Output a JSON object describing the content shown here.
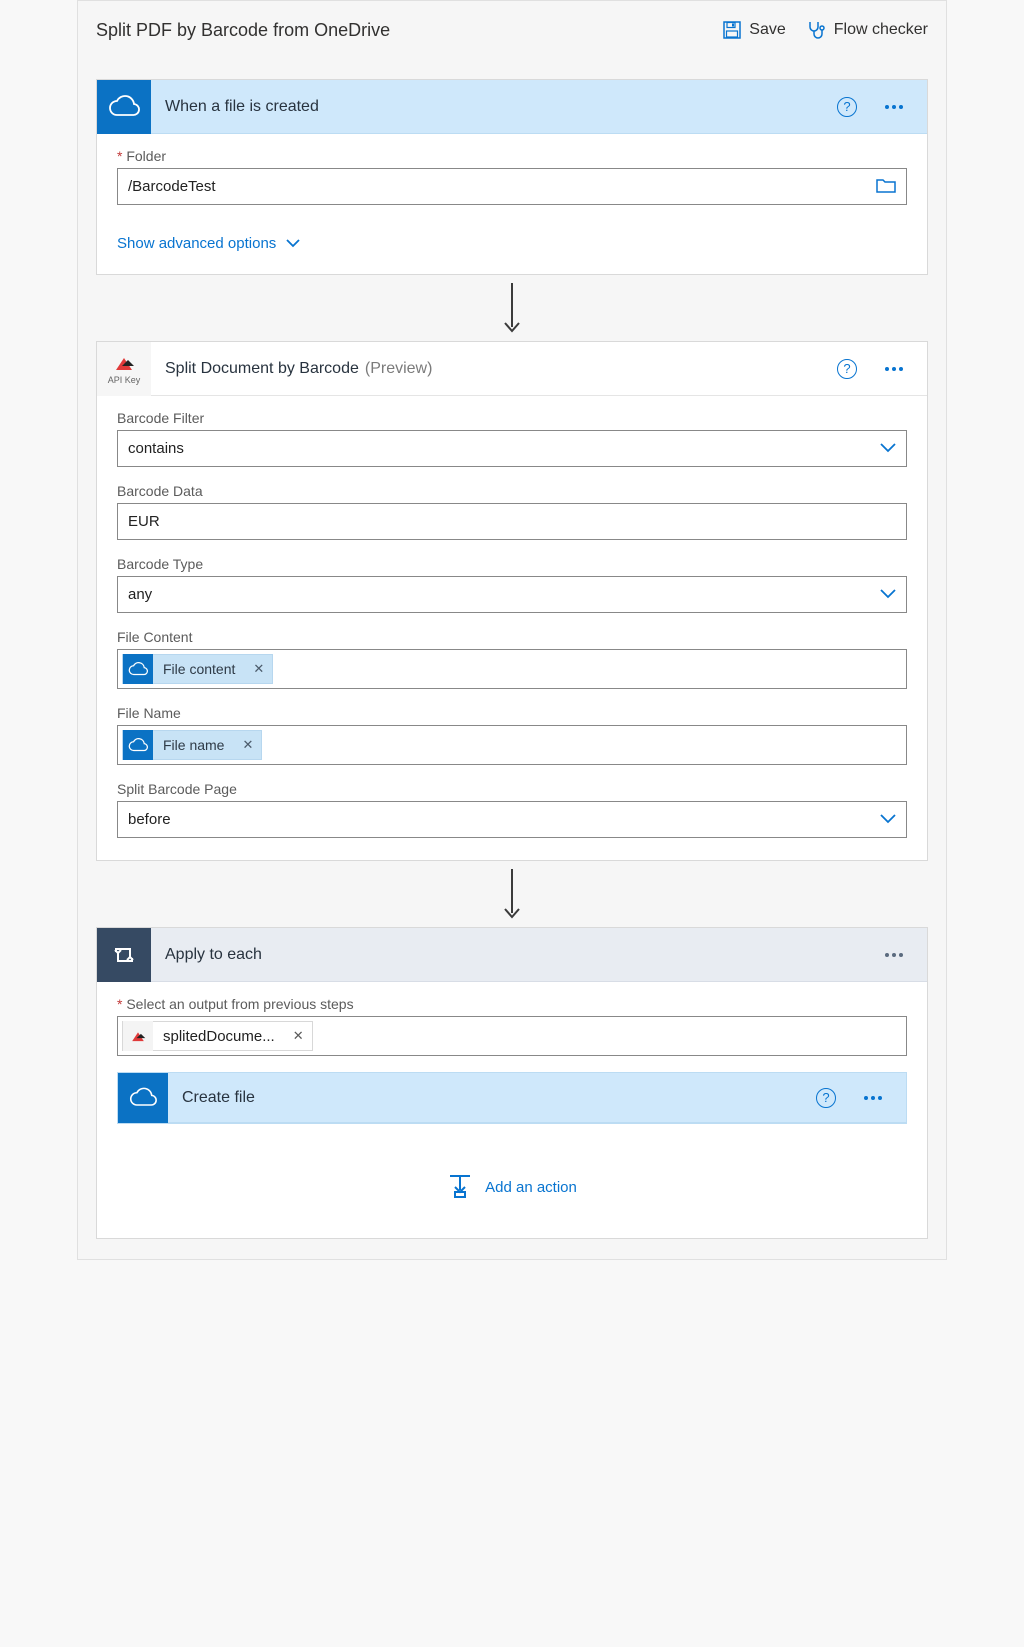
{
  "topbar": {
    "title": "Split PDF by Barcode from OneDrive",
    "save": "Save",
    "flow_checker": "Flow checker"
  },
  "trigger": {
    "icon_name": "onedrive",
    "title": "When a file is created",
    "fields": {
      "folder_label": "Folder",
      "folder_value": "/BarcodeTest"
    },
    "advanced": "Show advanced options"
  },
  "split": {
    "icon_caption": "API Key",
    "title": "Split Document by Barcode",
    "preview": "(Preview)",
    "fields": {
      "barcode_filter": {
        "label": "Barcode Filter",
        "value": "contains"
      },
      "barcode_data": {
        "label": "Barcode Data",
        "value": "EUR"
      },
      "barcode_type": {
        "label": "Barcode Type",
        "value": "any"
      },
      "file_content": {
        "label": "File Content",
        "token": "File content"
      },
      "file_name": {
        "label": "File Name",
        "token": "File name"
      },
      "split_page": {
        "label": "Split Barcode Page",
        "value": "before"
      }
    }
  },
  "apply": {
    "title": "Apply to each",
    "select_label": "Select an output from previous steps",
    "token": "splitedDocume...",
    "create_file": "Create file",
    "add_action": "Add an action"
  }
}
